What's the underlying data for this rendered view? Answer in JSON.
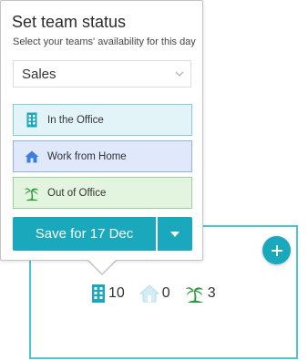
{
  "popover": {
    "title": "Set team status",
    "subtitle": "Select your teams' availability for this day",
    "department_select": {
      "value": "Sales",
      "icon": "chevron-down-icon"
    },
    "status_options": [
      {
        "label": "In the Office",
        "icon": "building-icon",
        "color": "#1aa8bd"
      },
      {
        "label": "Work from Home",
        "icon": "house-icon",
        "color": "#3b7ee0"
      },
      {
        "label": "Out of Office",
        "icon": "palm-tree-icon",
        "color": "#2a9a3a"
      }
    ],
    "save_button": {
      "label": "Save for 17 Dec"
    },
    "save_dropdown": {
      "icon": "caret-down-icon"
    }
  },
  "day_card": {
    "add_button": {
      "icon": "plus-icon"
    },
    "counts": [
      {
        "icon": "building-icon",
        "value": "10"
      },
      {
        "icon": "house-icon",
        "value": "0"
      },
      {
        "icon": "palm-tree-icon",
        "value": "3"
      }
    ]
  },
  "colors": {
    "accent": "#1aa8bd",
    "card_border": "#4fc3d1",
    "office_bg": "#e3f4f8",
    "home_bg": "#dfe9fb",
    "out_bg": "#e3f4df"
  }
}
